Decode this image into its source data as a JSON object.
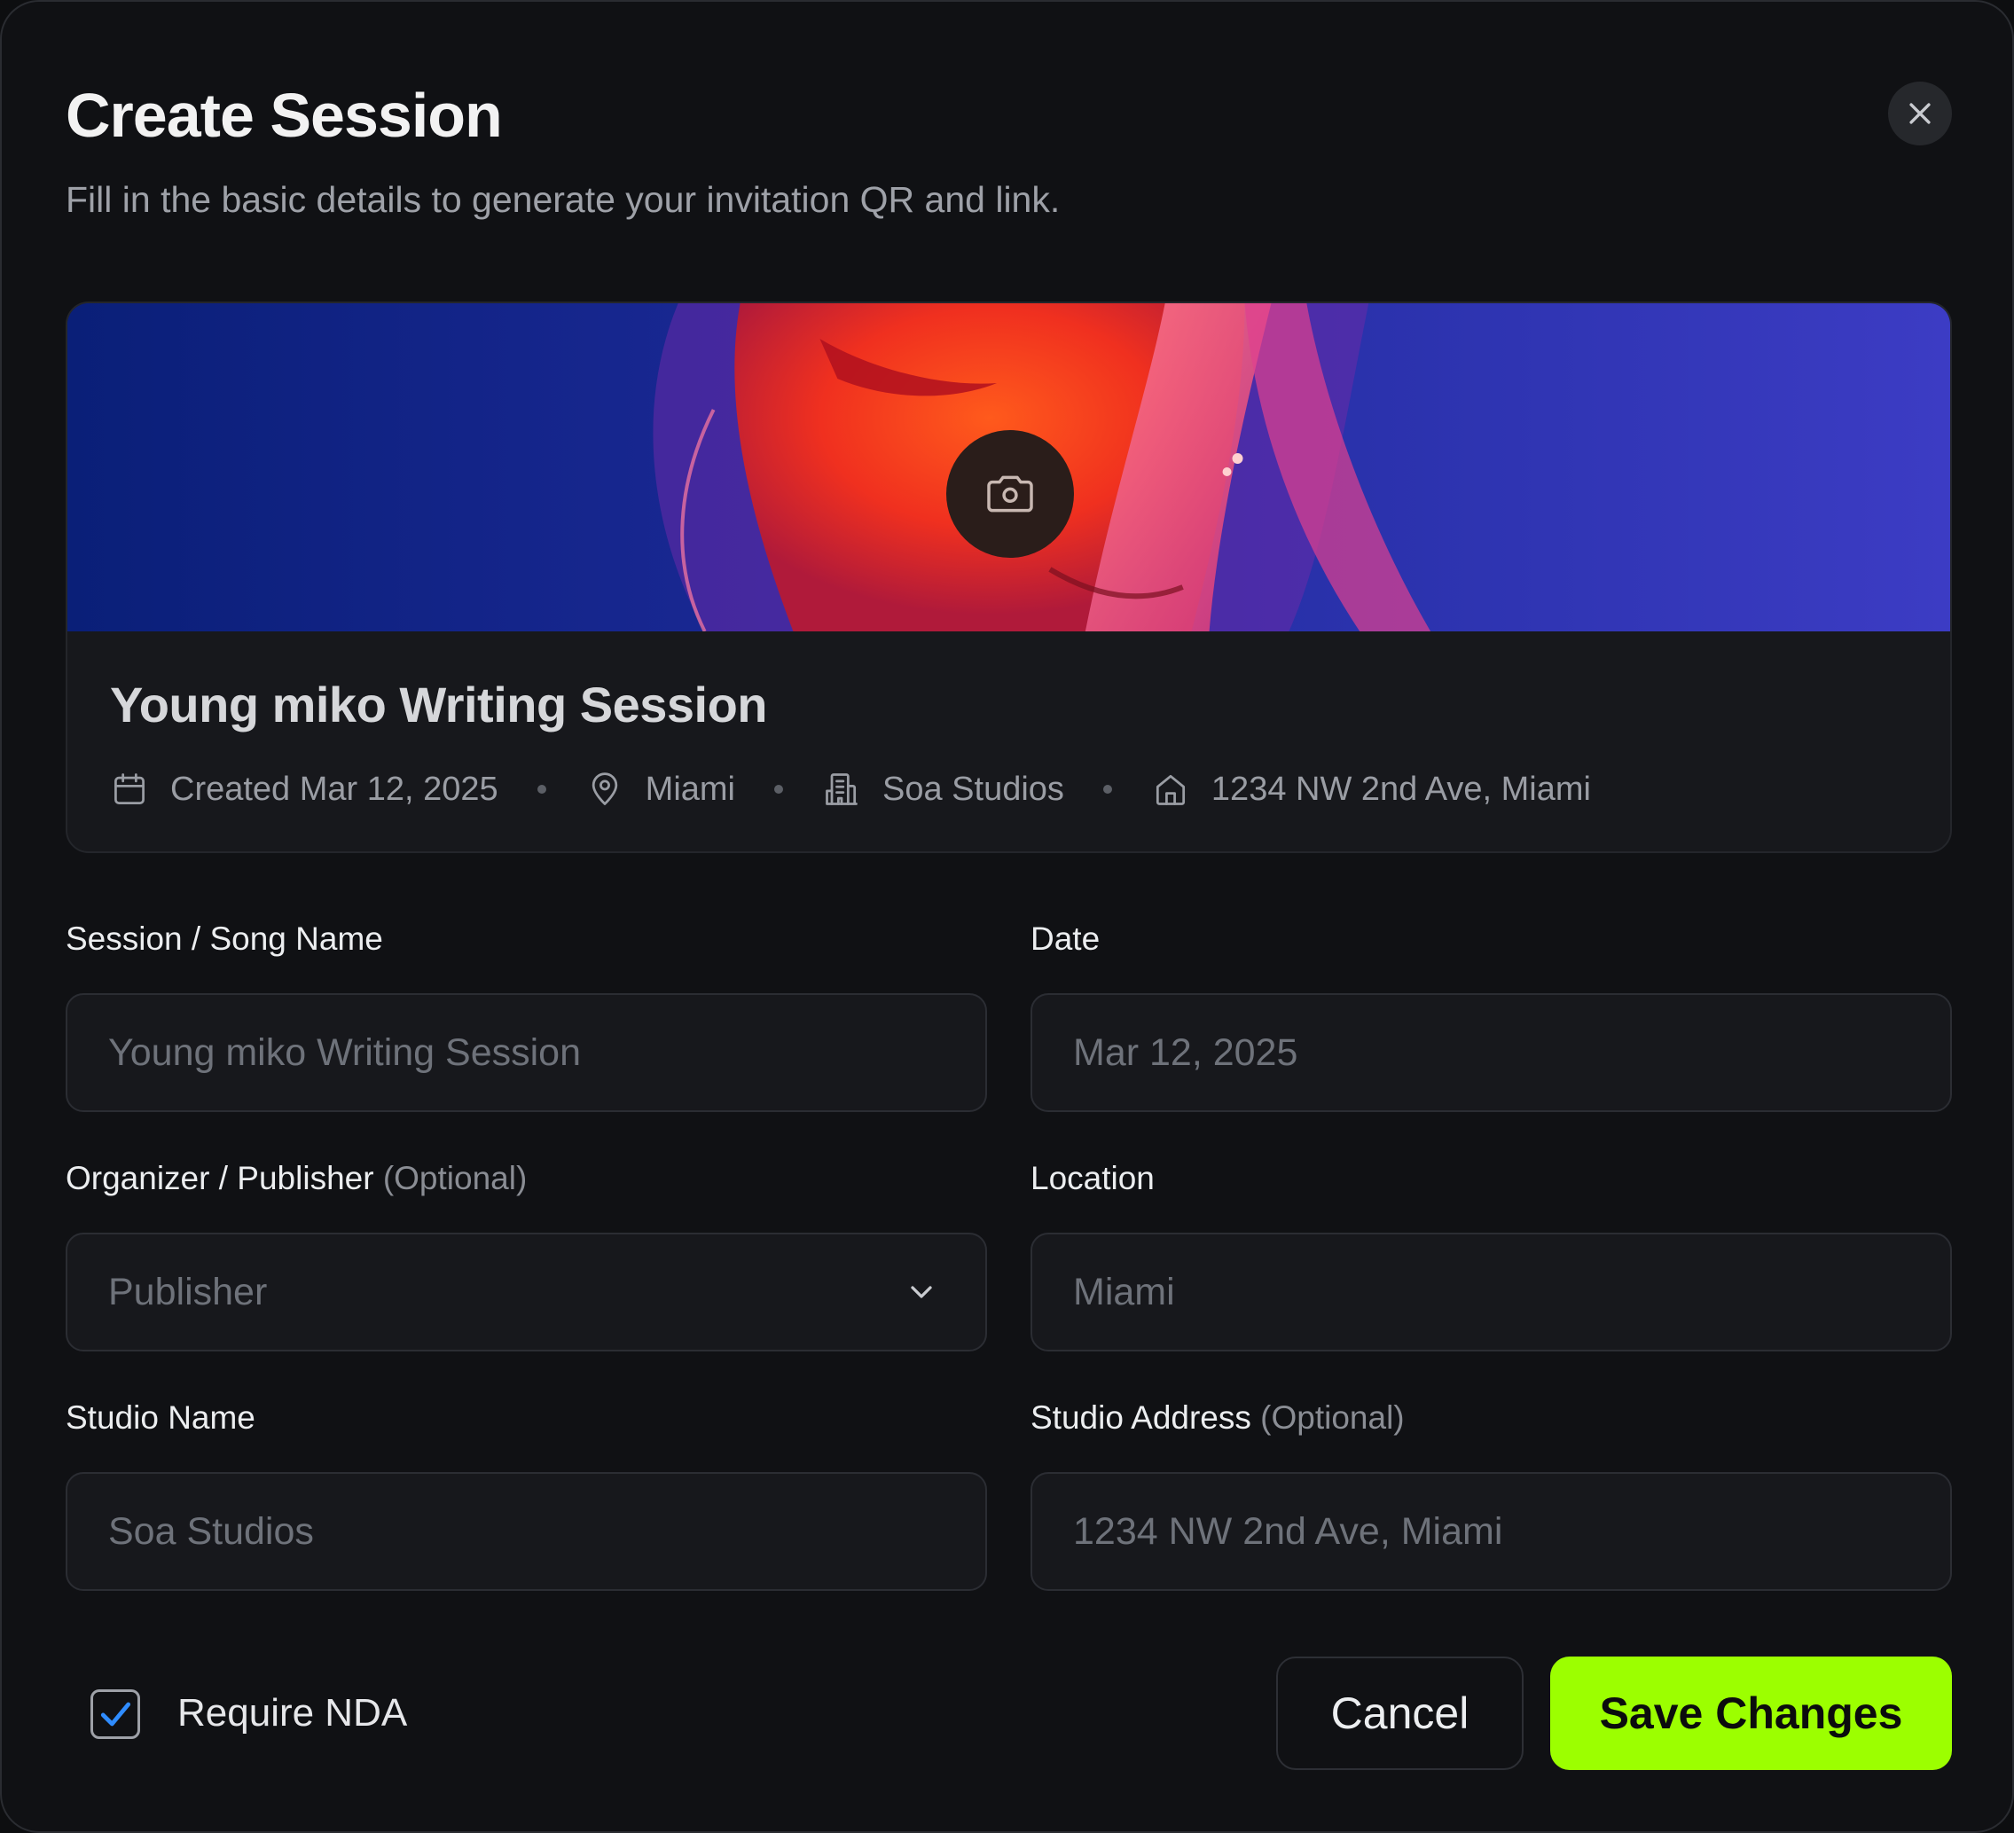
{
  "dialog": {
    "title": "Create Session",
    "subtitle": "Fill in the basic details to generate your invitation QR and link."
  },
  "preview": {
    "title": "Young miko Writing Session",
    "meta": {
      "created": "Created Mar 12, 2025",
      "city": "Miami",
      "studio": "Soa Studios",
      "address": "1234 NW 2nd Ave, Miami"
    },
    "icons": [
      "camera-icon",
      "calendar-icon",
      "map-pin-icon",
      "building-icon",
      "home-icon"
    ]
  },
  "form": {
    "session_name": {
      "label": "Session / Song Name",
      "value": "Young miko Writing Session"
    },
    "date": {
      "label": "Date",
      "value": "Mar 12, 2025"
    },
    "organizer": {
      "label": "Organizer / Publisher",
      "optional": "(Optional)",
      "value": "Publisher"
    },
    "location": {
      "label": "Location",
      "value": "Miami"
    },
    "studio_name": {
      "label": "Studio Name",
      "value": "Soa Studios"
    },
    "studio_address": {
      "label": "Studio Address",
      "optional": "(Optional)",
      "value": "1234 NW 2nd Ave, Miami"
    }
  },
  "footer": {
    "nda_label": "Require NDA",
    "nda_checked": true,
    "cancel_label": "Cancel",
    "save_label": "Save Changes"
  },
  "colors": {
    "accent": "#9cff00",
    "checkmark": "#2f8cff",
    "background": "#101114"
  }
}
